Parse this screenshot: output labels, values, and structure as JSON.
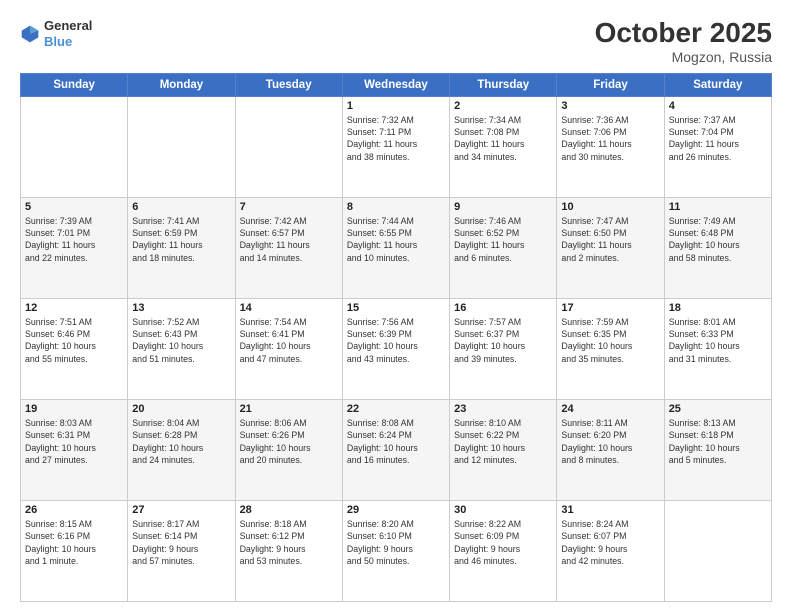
{
  "header": {
    "logo_line1": "General",
    "logo_line2": "Blue",
    "title": "October 2025",
    "subtitle": "Mogzon, Russia"
  },
  "days_of_week": [
    "Sunday",
    "Monday",
    "Tuesday",
    "Wednesday",
    "Thursday",
    "Friday",
    "Saturday"
  ],
  "weeks": [
    [
      {
        "day": "",
        "info": ""
      },
      {
        "day": "",
        "info": ""
      },
      {
        "day": "",
        "info": ""
      },
      {
        "day": "1",
        "info": "Sunrise: 7:32 AM\nSunset: 7:11 PM\nDaylight: 11 hours\nand 38 minutes."
      },
      {
        "day": "2",
        "info": "Sunrise: 7:34 AM\nSunset: 7:08 PM\nDaylight: 11 hours\nand 34 minutes."
      },
      {
        "day": "3",
        "info": "Sunrise: 7:36 AM\nSunset: 7:06 PM\nDaylight: 11 hours\nand 30 minutes."
      },
      {
        "day": "4",
        "info": "Sunrise: 7:37 AM\nSunset: 7:04 PM\nDaylight: 11 hours\nand 26 minutes."
      }
    ],
    [
      {
        "day": "5",
        "info": "Sunrise: 7:39 AM\nSunset: 7:01 PM\nDaylight: 11 hours\nand 22 minutes."
      },
      {
        "day": "6",
        "info": "Sunrise: 7:41 AM\nSunset: 6:59 PM\nDaylight: 11 hours\nand 18 minutes."
      },
      {
        "day": "7",
        "info": "Sunrise: 7:42 AM\nSunset: 6:57 PM\nDaylight: 11 hours\nand 14 minutes."
      },
      {
        "day": "8",
        "info": "Sunrise: 7:44 AM\nSunset: 6:55 PM\nDaylight: 11 hours\nand 10 minutes."
      },
      {
        "day": "9",
        "info": "Sunrise: 7:46 AM\nSunset: 6:52 PM\nDaylight: 11 hours\nand 6 minutes."
      },
      {
        "day": "10",
        "info": "Sunrise: 7:47 AM\nSunset: 6:50 PM\nDaylight: 11 hours\nand 2 minutes."
      },
      {
        "day": "11",
        "info": "Sunrise: 7:49 AM\nSunset: 6:48 PM\nDaylight: 10 hours\nand 58 minutes."
      }
    ],
    [
      {
        "day": "12",
        "info": "Sunrise: 7:51 AM\nSunset: 6:46 PM\nDaylight: 10 hours\nand 55 minutes."
      },
      {
        "day": "13",
        "info": "Sunrise: 7:52 AM\nSunset: 6:43 PM\nDaylight: 10 hours\nand 51 minutes."
      },
      {
        "day": "14",
        "info": "Sunrise: 7:54 AM\nSunset: 6:41 PM\nDaylight: 10 hours\nand 47 minutes."
      },
      {
        "day": "15",
        "info": "Sunrise: 7:56 AM\nSunset: 6:39 PM\nDaylight: 10 hours\nand 43 minutes."
      },
      {
        "day": "16",
        "info": "Sunrise: 7:57 AM\nSunset: 6:37 PM\nDaylight: 10 hours\nand 39 minutes."
      },
      {
        "day": "17",
        "info": "Sunrise: 7:59 AM\nSunset: 6:35 PM\nDaylight: 10 hours\nand 35 minutes."
      },
      {
        "day": "18",
        "info": "Sunrise: 8:01 AM\nSunset: 6:33 PM\nDaylight: 10 hours\nand 31 minutes."
      }
    ],
    [
      {
        "day": "19",
        "info": "Sunrise: 8:03 AM\nSunset: 6:31 PM\nDaylight: 10 hours\nand 27 minutes."
      },
      {
        "day": "20",
        "info": "Sunrise: 8:04 AM\nSunset: 6:28 PM\nDaylight: 10 hours\nand 24 minutes."
      },
      {
        "day": "21",
        "info": "Sunrise: 8:06 AM\nSunset: 6:26 PM\nDaylight: 10 hours\nand 20 minutes."
      },
      {
        "day": "22",
        "info": "Sunrise: 8:08 AM\nSunset: 6:24 PM\nDaylight: 10 hours\nand 16 minutes."
      },
      {
        "day": "23",
        "info": "Sunrise: 8:10 AM\nSunset: 6:22 PM\nDaylight: 10 hours\nand 12 minutes."
      },
      {
        "day": "24",
        "info": "Sunrise: 8:11 AM\nSunset: 6:20 PM\nDaylight: 10 hours\nand 8 minutes."
      },
      {
        "day": "25",
        "info": "Sunrise: 8:13 AM\nSunset: 6:18 PM\nDaylight: 10 hours\nand 5 minutes."
      }
    ],
    [
      {
        "day": "26",
        "info": "Sunrise: 8:15 AM\nSunset: 6:16 PM\nDaylight: 10 hours\nand 1 minute."
      },
      {
        "day": "27",
        "info": "Sunrise: 8:17 AM\nSunset: 6:14 PM\nDaylight: 9 hours\nand 57 minutes."
      },
      {
        "day": "28",
        "info": "Sunrise: 8:18 AM\nSunset: 6:12 PM\nDaylight: 9 hours\nand 53 minutes."
      },
      {
        "day": "29",
        "info": "Sunrise: 8:20 AM\nSunset: 6:10 PM\nDaylight: 9 hours\nand 50 minutes."
      },
      {
        "day": "30",
        "info": "Sunrise: 8:22 AM\nSunset: 6:09 PM\nDaylight: 9 hours\nand 46 minutes."
      },
      {
        "day": "31",
        "info": "Sunrise: 8:24 AM\nSunset: 6:07 PM\nDaylight: 9 hours\nand 42 minutes."
      },
      {
        "day": "",
        "info": ""
      }
    ]
  ]
}
